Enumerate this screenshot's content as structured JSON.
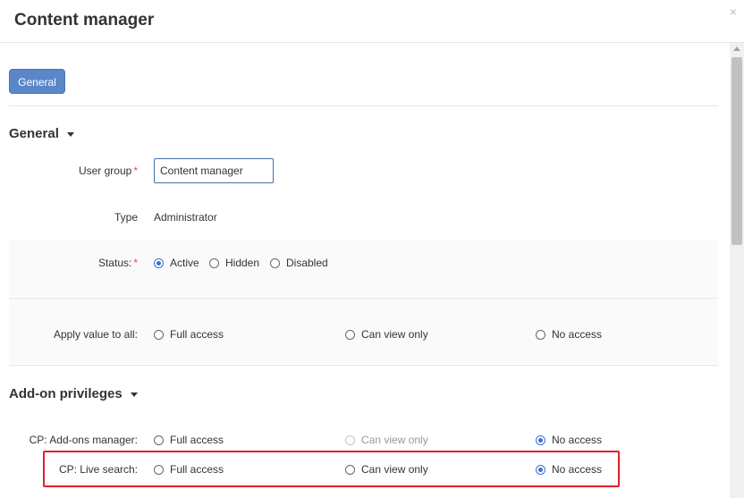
{
  "dialog": {
    "title": "Content manager",
    "close_icon": "×"
  },
  "tabs": {
    "general_label": "General"
  },
  "general_section": {
    "title": "General",
    "user_group": {
      "label": "User group",
      "required": "*",
      "value": "Content manager"
    },
    "type": {
      "label": "Type",
      "value": "Administrator"
    },
    "status": {
      "label": "Status:",
      "required": "*",
      "options": [
        "Active",
        "Hidden",
        "Disabled"
      ],
      "selected": "Active"
    }
  },
  "apply_all": {
    "label": "Apply value to all:",
    "options": [
      "Full access",
      "Can view only",
      "No access"
    ]
  },
  "addon_section": {
    "title": "Add-on privileges",
    "rows": [
      {
        "label": "CP: Add-ons manager:",
        "options": [
          "Full access",
          "Can view only",
          "No access"
        ],
        "selected": "No access",
        "disabled": "Can view only"
      },
      {
        "label": "CP: Live search:",
        "options": [
          "Full access",
          "Can view only",
          "No access"
        ],
        "selected": "No access"
      }
    ]
  },
  "colors": {
    "accent": "#5b87c9",
    "radio_checked": "#3d6fd6",
    "required": "#d9534f",
    "highlight": "#e0202a"
  }
}
